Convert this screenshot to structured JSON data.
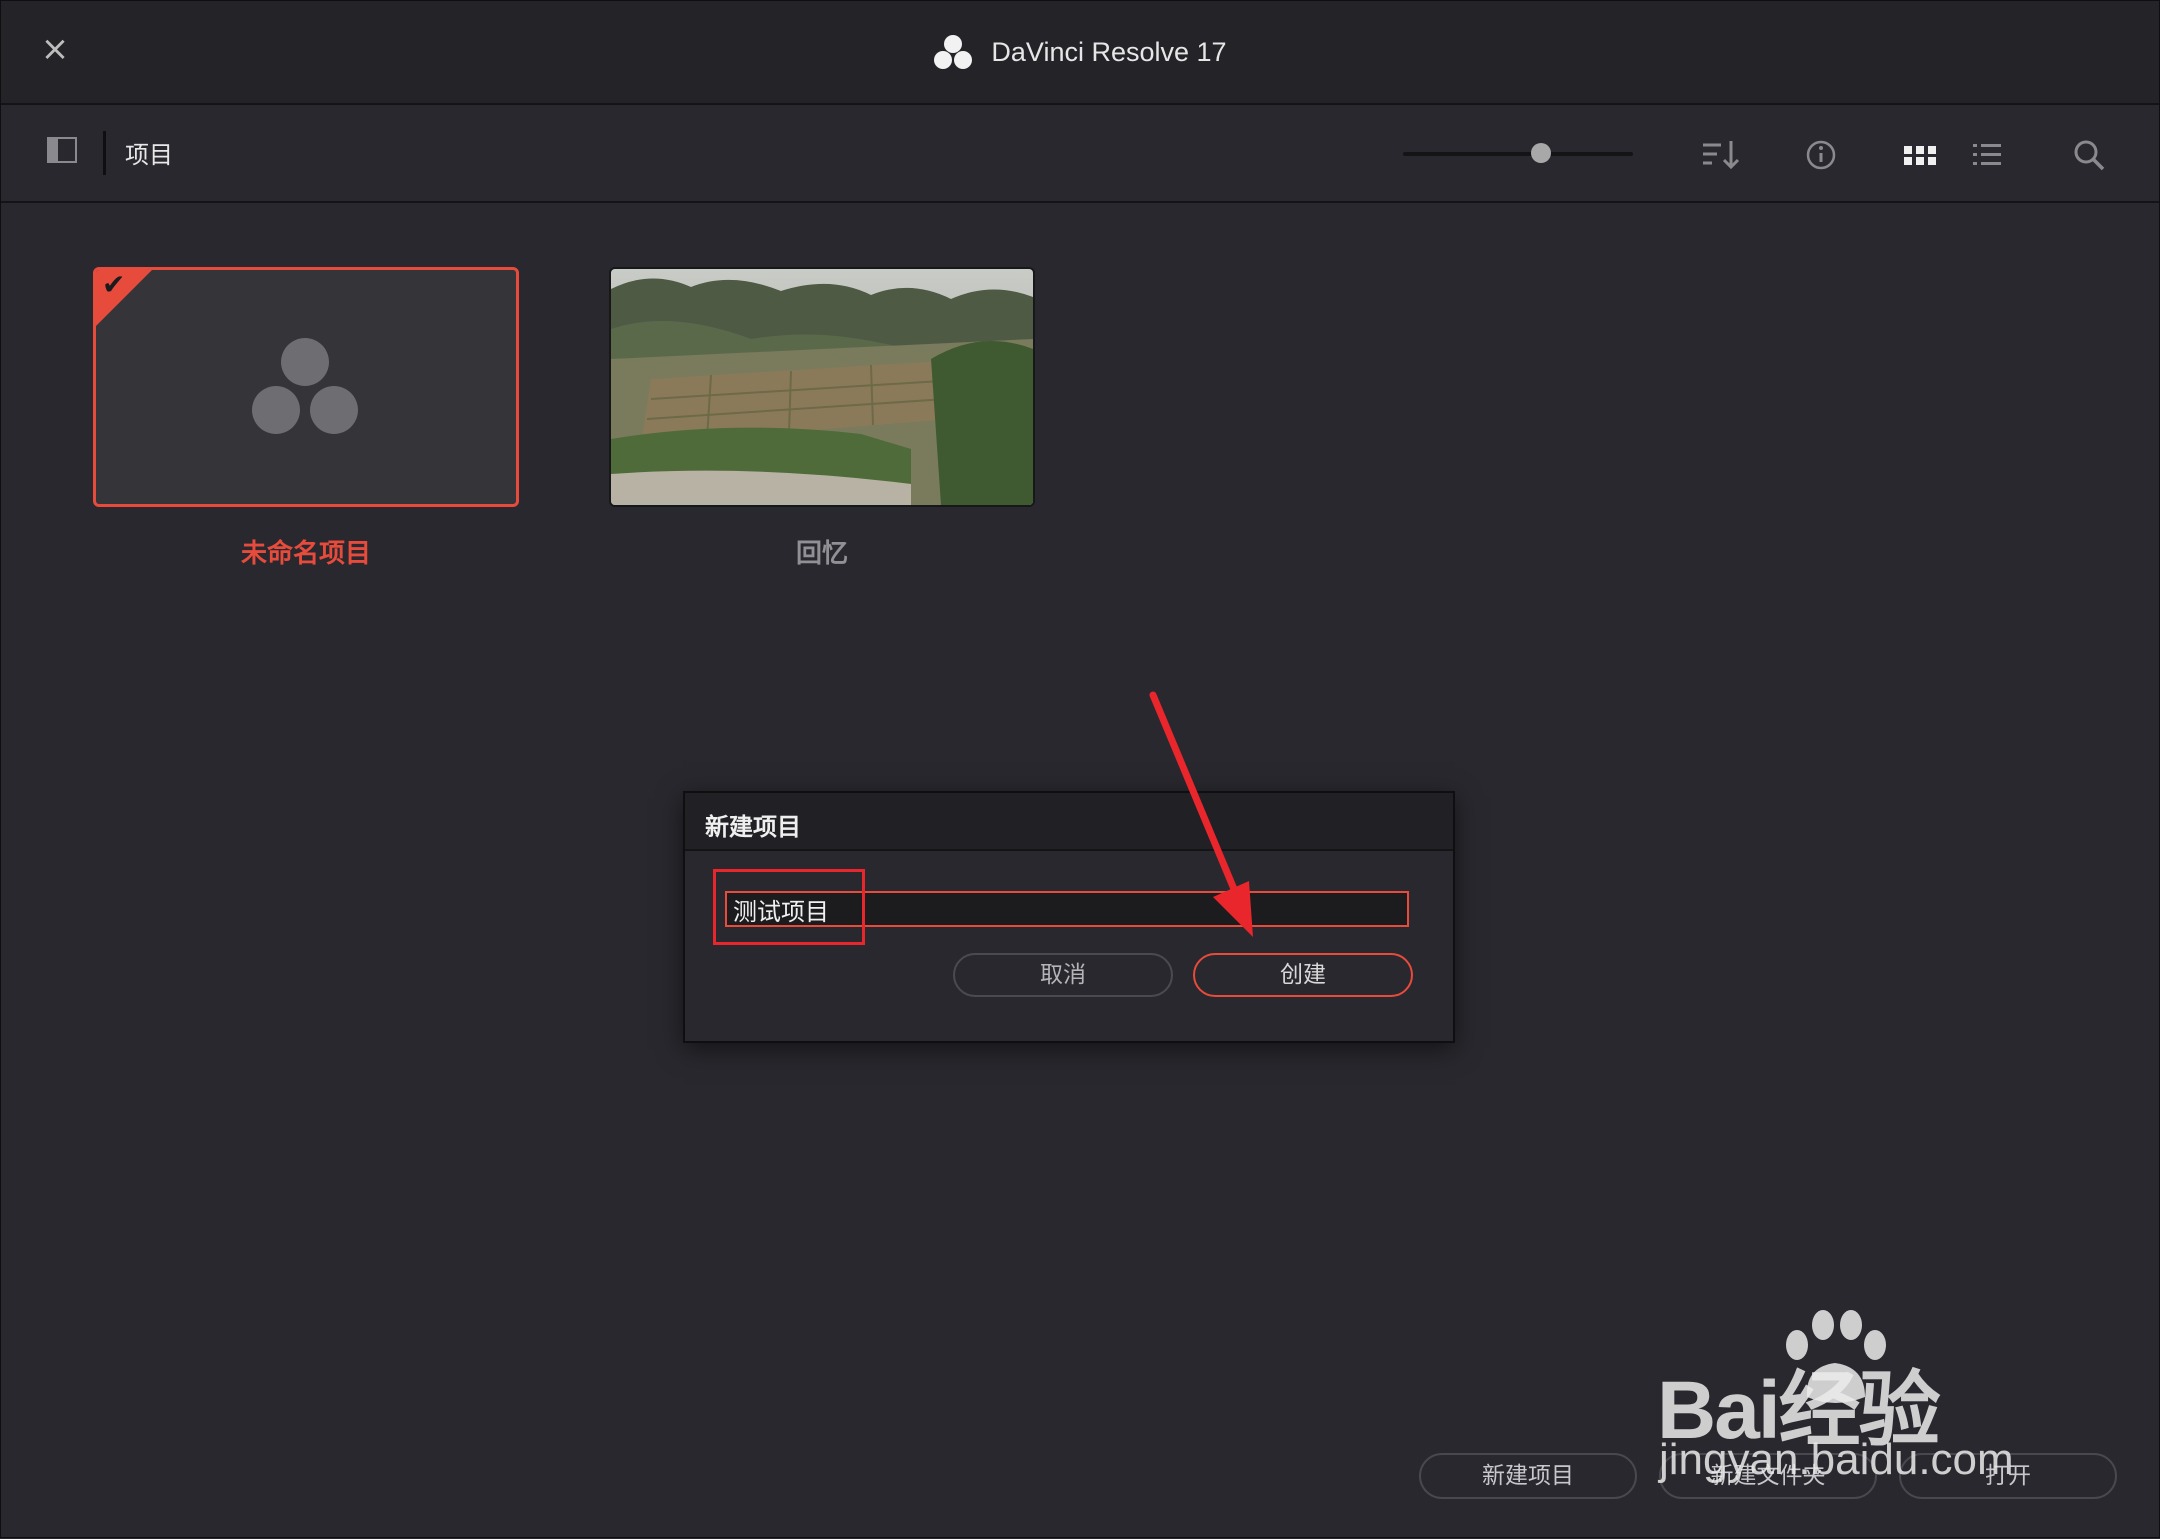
{
  "window": {
    "title": "DaVinci Resolve 17",
    "close_glyph": "×"
  },
  "toolbar": {
    "label": "项目",
    "zoom_level": 0.6,
    "icons": [
      "sidebar-toggle-icon",
      "sort-icon",
      "info-icon",
      "grid-view-icon",
      "list-view-icon",
      "search-icon"
    ]
  },
  "projects": [
    {
      "name": "未命名项目",
      "selected": true,
      "thumbnail": "davinci-logo-placeholder"
    },
    {
      "name": "回忆",
      "selected": false,
      "thumbnail": "landscape-photo"
    }
  ],
  "dialog": {
    "title": "新建项目",
    "input_value": "测试项目",
    "cancel_label": "取消",
    "create_label": "创建"
  },
  "bottom_buttons": {
    "new_project": "新建项目",
    "new_folder": "新建文件夹",
    "open": "打开"
  },
  "watermark": {
    "brand": "Bai经验",
    "url": "jingyan.baidu.com"
  },
  "colors": {
    "accent": "#e64b3c",
    "annotation": "#e8262c",
    "background": "#28282e"
  }
}
